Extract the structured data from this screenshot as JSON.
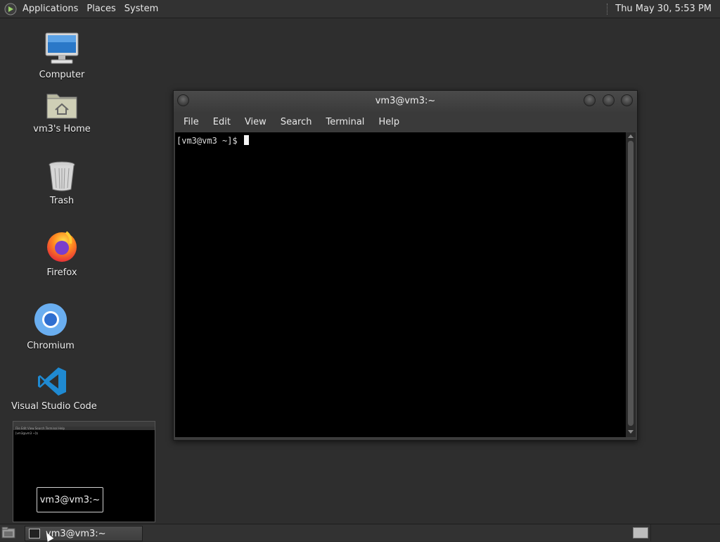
{
  "top_panel": {
    "menus": [
      "Applications",
      "Places",
      "System"
    ],
    "clock": "Thu May 30,  5:53 PM",
    "logo_icon": "gnome-foot-icon"
  },
  "desktop_icons": [
    {
      "label": "Computer",
      "icon": "computer-icon"
    },
    {
      "label": "vm3's Home",
      "icon": "home-folder-icon"
    },
    {
      "label": "Trash",
      "icon": "trash-icon"
    },
    {
      "label": "Firefox",
      "icon": "firefox-icon"
    },
    {
      "label": "Chromium",
      "icon": "chromium-icon"
    },
    {
      "label": "Visual Studio Code",
      "icon": "vscode-icon"
    }
  ],
  "terminal": {
    "title": "vm3@vm3:~",
    "menu": [
      "File",
      "Edit",
      "View",
      "Search",
      "Terminal",
      "Help"
    ],
    "prompt": "[vm3@vm3 ~]$ "
  },
  "preview": {
    "label": "vm3@vm3:~",
    "menu_text": "File  Edit  View  Search  Terminal  Help",
    "prompt_text": "[vm3@vm3 ~]$"
  },
  "bottom_panel": {
    "task_label": "vm3@vm3:~"
  },
  "colors": {
    "desktop_bg": "#2e2e2e",
    "panel_bg": "#323232",
    "terminal_bg": "#000000"
  }
}
